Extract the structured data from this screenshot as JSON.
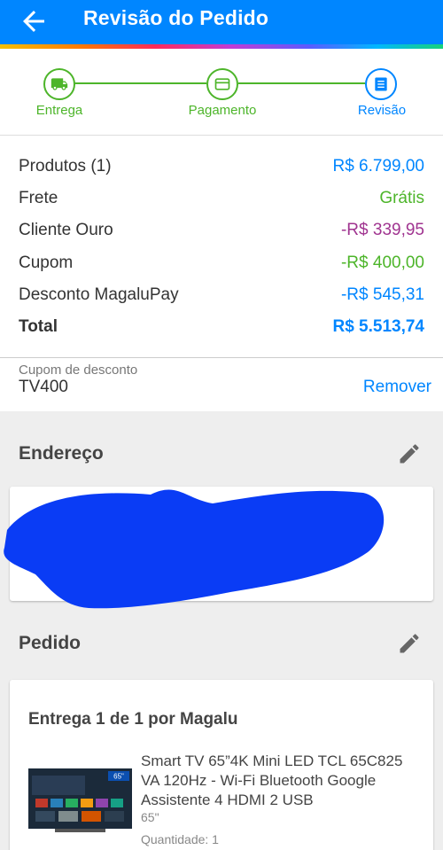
{
  "header": {
    "title": "Revisão do Pedido",
    "back_icon": "arrow-left-icon"
  },
  "stepper": {
    "steps": [
      {
        "label": "Entrega",
        "icon": "truck-icon",
        "status": "done"
      },
      {
        "label": "Pagamento",
        "icon": "card-icon",
        "status": "done"
      },
      {
        "label": "Revisão",
        "icon": "list-icon",
        "status": "current"
      }
    ]
  },
  "summary": {
    "rows": [
      {
        "label": "Produtos (1)",
        "value": "R$ 6.799,00",
        "color": "#0086ff"
      },
      {
        "label": "Frete",
        "value": "Grátis",
        "color": "#4db52a"
      },
      {
        "label": "Cliente Ouro",
        "value": "-R$ 339,95",
        "color": "#a03490"
      },
      {
        "label": "Cupom",
        "value": "-R$ 400,00",
        "color": "#4db52a"
      },
      {
        "label": "Desconto MagaluPay",
        "value": "-R$ 545,31",
        "color": "#0086ff"
      },
      {
        "label": "Total",
        "value": "R$ 5.513,74",
        "color": "#0086ff"
      }
    ]
  },
  "coupon": {
    "placeholder": "Cupom de desconto",
    "code": "TV400",
    "remove_label": "Remover"
  },
  "address": {
    "title": "Endereço"
  },
  "order": {
    "title": "Pedido",
    "delivery": "Entrega 1 de 1 por Magalu",
    "product": {
      "name": "Smart TV 65”4K Mini LED TCL 65C825 VA 120Hz - Wi-Fi Bluetooth Google Assistente 4 HDMI 2 USB",
      "size": "65\"",
      "quantity": "Quantidade:  1",
      "badge": "65\""
    }
  },
  "colors": {
    "primary": "#0086ff",
    "success": "#4db52a",
    "ouro": "#a03490"
  }
}
